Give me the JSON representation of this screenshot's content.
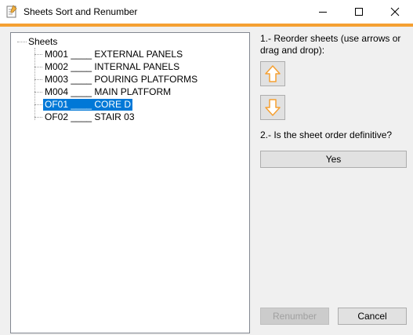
{
  "window": {
    "title": "Sheets Sort and Renumber",
    "accent_color": "#f5a032"
  },
  "titlebar_buttons": {
    "minimize_icon": "minimize-icon",
    "maximize_icon": "maximize-icon",
    "close_icon": "close-icon"
  },
  "tree": {
    "root_label": "Sheets",
    "items": [
      {
        "label": "M001 ____ EXTERNAL PANELS",
        "selected": false
      },
      {
        "label": "M002 ____ INTERNAL PANELS",
        "selected": false
      },
      {
        "label": "M003 ____ POURING PLATFORMS",
        "selected": false
      },
      {
        "label": "M004 ____ MAIN PLATFORM",
        "selected": false
      },
      {
        "label": "OF01 ____ CORE D",
        "selected": true
      },
      {
        "label": "OF02 ____ STAIR 03",
        "selected": false
      }
    ],
    "selection_color": "#0078d7"
  },
  "reorder": {
    "instruction": "1.- Reorder sheets (use arrows or drag and drop):",
    "up_icon": "arrow-up-icon",
    "down_icon": "arrow-down-icon",
    "arrow_color": "#f5a032"
  },
  "definitive": {
    "question": "2.- Is the sheet order definitive?",
    "yes_label": "Yes"
  },
  "footer": {
    "renumber_label": "Renumber",
    "renumber_enabled": false,
    "cancel_label": "Cancel"
  }
}
